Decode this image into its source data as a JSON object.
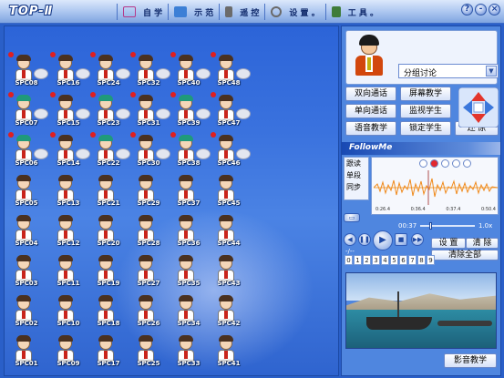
{
  "app": {
    "logo": "TOP-Ⅱ",
    "menu": [
      {
        "label": "自 学",
        "icon": "self-study-icon",
        "color": "#b53a8a"
      },
      {
        "label": "示 范",
        "icon": "demo-icon",
        "color": "#3c7fd6"
      },
      {
        "label": "遥 控",
        "icon": "remote-control-icon",
        "color": "#6b6b6b"
      },
      {
        "label": "设 置 。",
        "icon": "settings-icon",
        "color": "#6a6a6a"
      },
      {
        "label": "工 具 。",
        "icon": "tools-icon",
        "color": "#3f7c3a"
      }
    ],
    "window_buttons": [
      "?",
      "-",
      "×"
    ]
  },
  "students": [
    [
      "SPC08",
      "SPC16",
      "SPC24",
      "SPC32",
      "SPC40",
      "SPC48"
    ],
    [
      "SPC07",
      "SPC15",
      "SPC23",
      "SPC31",
      "SPC39",
      "SPC47"
    ],
    [
      "SPC06",
      "SPC14",
      "SPC22",
      "SPC30",
      "SPC38",
      "SPC46"
    ],
    [
      "SPC05",
      "SPC13",
      "SPC21",
      "SPC29",
      "SPC37",
      "SPC45"
    ],
    [
      "SPC04",
      "SPC12",
      "SPC20",
      "SPC28",
      "SPC36",
      "SPC44"
    ],
    [
      "SPC03",
      "SPC11",
      "SPC19",
      "SPC27",
      "SPC35",
      "SPC43"
    ],
    [
      "SPC02",
      "SPC10",
      "SPC18",
      "SPC26",
      "SPC34",
      "SPC42"
    ],
    [
      "SPC01",
      "SPC09",
      "SPC17",
      "SPC25",
      "SPC33",
      "SPC41"
    ]
  ],
  "panel": {
    "group_select": "分组讨论",
    "buttons": {
      "two_way_call": "双向通话",
      "screen_teaching": "屏幕教学",
      "one_way_call": "单向通话",
      "monitor_students": "监视学生",
      "voice_teaching": "语音教学",
      "lock_students": "锁定学生",
      "restore": "还 原"
    },
    "followme_title": "FollowMe",
    "followme_modes": [
      "跟读",
      "单段",
      "同步"
    ],
    "wave_times": [
      "0:26.4",
      "0:36.4",
      "0:37.4",
      "0:50.4"
    ],
    "elapsed": "00:37",
    "speed": "1.0x",
    "digits_label": "-/--",
    "digits": [
      "0",
      "1",
      "2",
      "3",
      "4",
      "5",
      "6",
      "7",
      "8",
      "9"
    ],
    "setup": "设 置",
    "clear": "清 除",
    "clear_all": "清除全部",
    "video_teaching": "影音教学"
  }
}
